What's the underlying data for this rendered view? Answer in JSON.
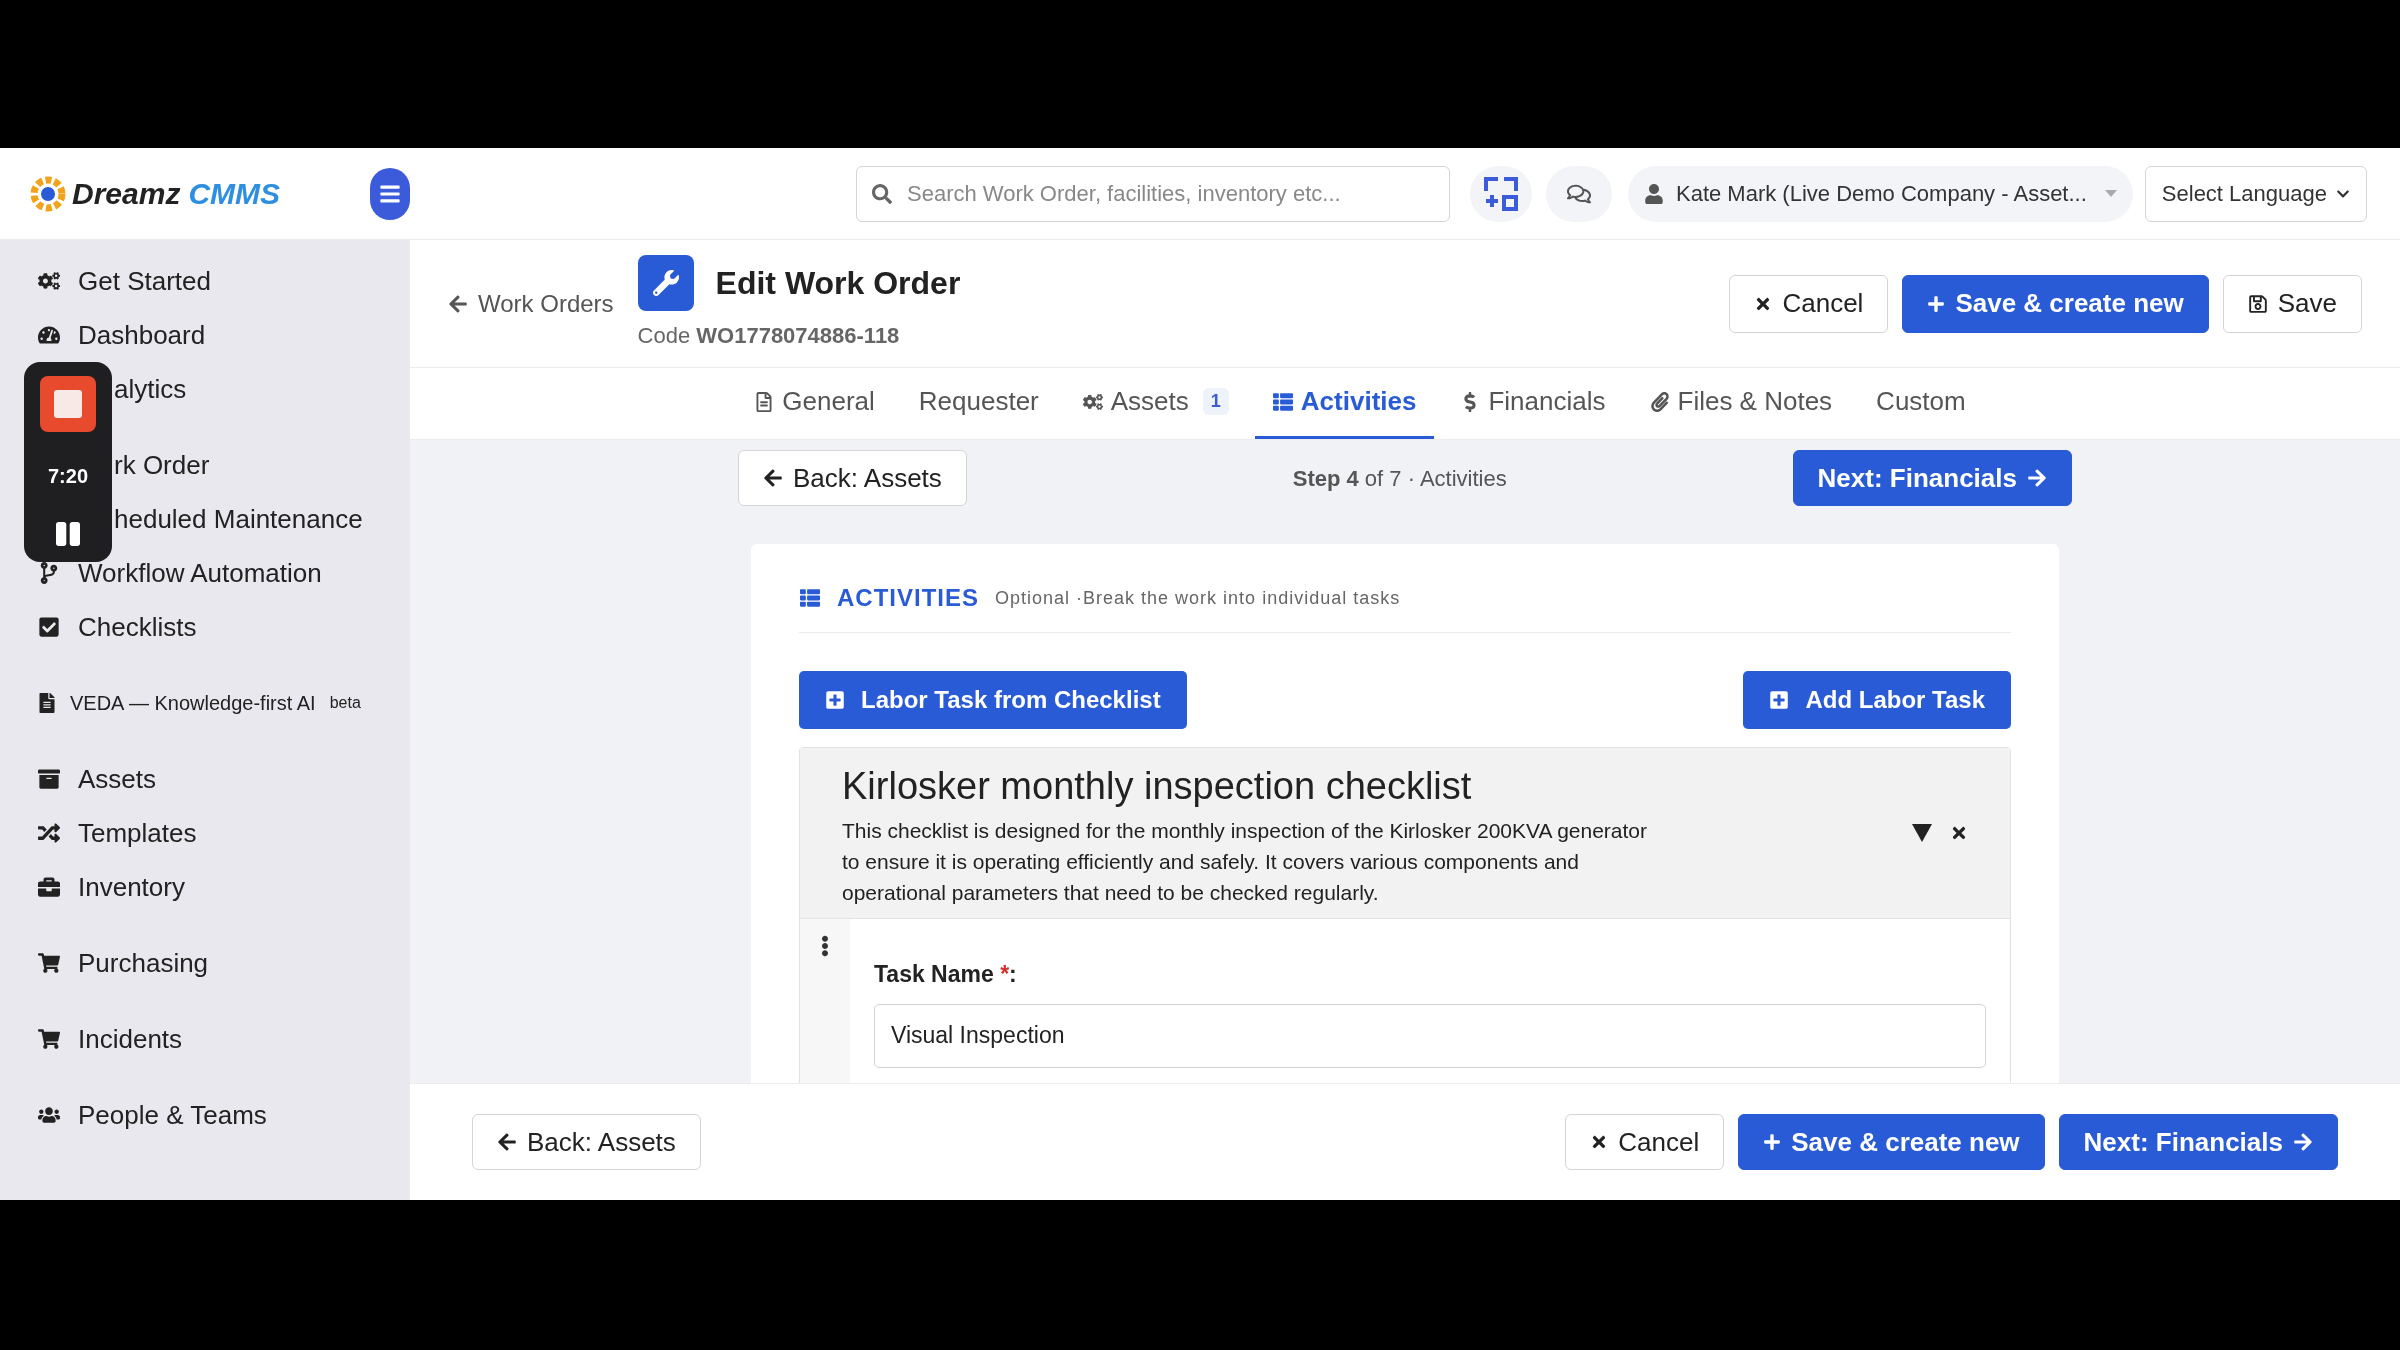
{
  "app": {
    "logo_text": "Dreamz",
    "logo_accent": "CMMS"
  },
  "search": {
    "placeholder": "Search Work Order, facilities, inventory etc..."
  },
  "user": {
    "label": "Kate Mark (Live Demo Company - Asset..."
  },
  "language": {
    "value": "Select Language"
  },
  "recorder": {
    "time": "7:20"
  },
  "sidebar": {
    "groups": [
      [
        {
          "label": "Get Started",
          "kind": "full"
        },
        {
          "label": "Dashboard",
          "kind": "full"
        },
        {
          "label": "alytics",
          "kind": "covered"
        }
      ],
      [
        {
          "label": "rk Order",
          "kind": "covered"
        },
        {
          "label": "heduled Maintenance",
          "kind": "covered"
        },
        {
          "label": "Workflow Automation",
          "kind": "full"
        },
        {
          "label": "Checklists",
          "kind": "full"
        }
      ],
      [
        {
          "label": "VEDA — Knowledge-first AI",
          "badge": "beta",
          "kind": "small"
        }
      ],
      [
        {
          "label": "Assets",
          "kind": "full"
        },
        {
          "label": "Templates",
          "kind": "full"
        },
        {
          "label": "Inventory",
          "kind": "full"
        }
      ],
      [
        {
          "label": "Purchasing",
          "kind": "full"
        }
      ],
      [
        {
          "label": "Incidents",
          "kind": "full"
        }
      ],
      [
        {
          "label": "People & Teams",
          "kind": "full"
        }
      ]
    ]
  },
  "page": {
    "back_link": "Work Orders",
    "title": "Edit Work Order",
    "code": "Code **WO1778074886-118**",
    "actions": [
      {
        "label": "Cancel",
        "kind": "cancel"
      },
      {
        "label": "Save & create new",
        "kind": "save_new"
      },
      {
        "label": "Save",
        "kind": "save"
      }
    ]
  },
  "tabs": [
    {
      "label": "General",
      "selected": false
    },
    {
      "label": "Requester",
      "selected": false
    },
    {
      "label": "Assets",
      "badge": "1",
      "selected": false
    },
    {
      "label": "Activities",
      "selected": true
    },
    {
      "label": "Financials",
      "selected": false
    },
    {
      "label": "Files & Notes",
      "selected": false
    },
    {
      "label": "Custom",
      "selected": false
    }
  ],
  "stepper": {
    "back": "Back: Assets",
    "text": "**Step 4** of 7 · Activities",
    "next": "Next: Financials"
  },
  "activities": {
    "title": "ACTIVITIES",
    "hint": "Optional ·Break the work into individual tasks",
    "buttons": [
      "Labor Task from Checklist",
      "Add Labor Task"
    ],
    "checklist": {
      "title": "Kirlosker monthly inspection checklist",
      "description": "This checklist is designed for the monthly inspection of the Kirlosker 200KVA generator to ensure it is operating efficiently and safely. It covers various components and operational parameters that need to be checked regularly."
    },
    "task": {
      "label": "Task Name",
      "required_mark": "*",
      "suffix": ":",
      "value": "Visual Inspection"
    }
  },
  "footer": {
    "buttons": [
      {
        "label": "Back: Assets",
        "kind": "back"
      },
      {
        "label": "Cancel",
        "kind": "cancel"
      },
      {
        "label": "Save & create new",
        "kind": "save_new"
      },
      {
        "label": "Next: Financials",
        "kind": "next"
      }
    ]
  }
}
